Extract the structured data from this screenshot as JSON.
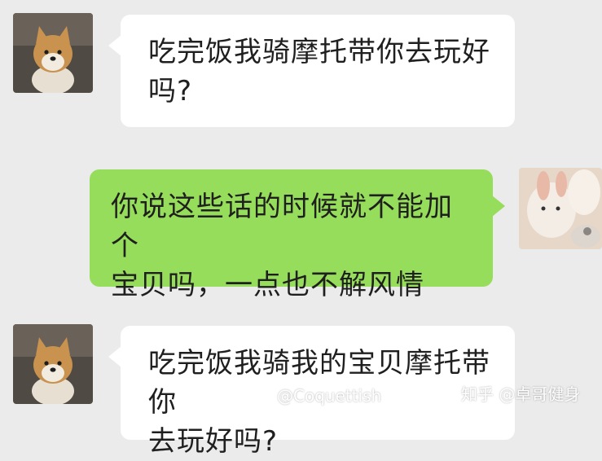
{
  "conversation": {
    "messages": [
      {
        "sender": "contact",
        "avatar": "shiba-dog-avatar",
        "text": "吃完饭我骑摩托带你去玩好\n吗?"
      },
      {
        "sender": "self",
        "avatar": "bunny-plush-avatar",
        "text": "你说这些话的时候就不能加个\n宝贝吗，一点也不解风情"
      },
      {
        "sender": "contact",
        "avatar": "shiba-dog-avatar",
        "text": "吃完饭我骑我的宝贝摩托带你\n去玩好吗?"
      }
    ]
  },
  "watermarks": {
    "weibo": "@Coquettish",
    "zhihu": "知乎 @卓哥健身"
  },
  "colors": {
    "background": "#ebebeb",
    "incoming_bubble": "#ffffff",
    "outgoing_bubble": "#95dd5a",
    "text": "#1f1f1f"
  }
}
